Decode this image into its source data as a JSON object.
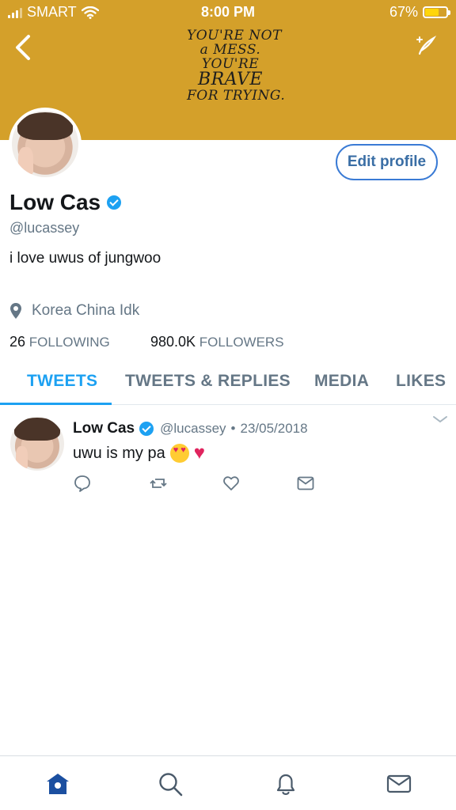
{
  "status_bar": {
    "carrier": "SMART",
    "time": "8:00 PM",
    "battery": "67%",
    "battery_level": 0.67
  },
  "banner": {
    "color": "#d4a02a",
    "quote_lines": [
      "YOU'RE NOT",
      "a MESS.",
      "YOU'RE",
      "BRAVE",
      "FOR TRYING."
    ]
  },
  "profile": {
    "name": "Low Cas",
    "handle": "@lucassey",
    "bio": "i love uwus of jungwoo",
    "location": "Korea China Idk",
    "following_count": "26",
    "following_label": "FOLLOWING",
    "followers_count": "980.0K",
    "followers_label": "FOLLOWERS",
    "edit_button": "Edit profile"
  },
  "tabs": [
    {
      "label": "TWEETS",
      "active": true
    },
    {
      "label": "TWEETS & REPLIES",
      "active": false
    },
    {
      "label": "MEDIA",
      "active": false
    },
    {
      "label": "LIKES",
      "active": false
    }
  ],
  "tweet": {
    "name": "Low Cas",
    "handle": "@lucassey",
    "separator": "•",
    "date": "23/05/2018",
    "text": "uwu is my pa"
  },
  "colors": {
    "accent": "#1da1f2",
    "muted": "#657786",
    "banner": "#d4a02a"
  },
  "icons": {
    "status_bar": [
      "signal-icon",
      "wifi-icon",
      "battery-icon"
    ],
    "header": [
      "back-icon",
      "compose-icon"
    ],
    "tweet_actions": [
      "reply-icon",
      "retweet-icon",
      "like-icon",
      "dm-icon"
    ],
    "bottom_nav": [
      "home-icon",
      "search-icon",
      "notifications-icon",
      "messages-icon"
    ]
  }
}
